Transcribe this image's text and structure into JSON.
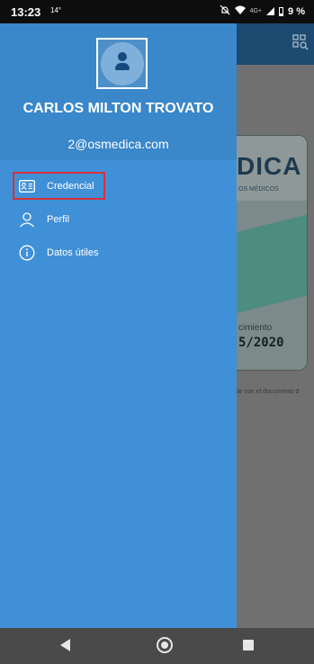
{
  "status_bar": {
    "time": "13:23",
    "temperature": "14°",
    "network": "4G+",
    "battery": "9 %"
  },
  "background_app": {
    "card_brand": "DICA",
    "card_subtitle": "OS MÉDICOS",
    "card_label": "cimiento",
    "card_date": "5/2020",
    "footnote": "se con el documento d"
  },
  "drawer": {
    "user_name": "CARLOS MILTON TROVATO",
    "user_email": "2@osmedica.com",
    "menu": [
      {
        "label": "Credencial",
        "icon": "id-card-icon"
      },
      {
        "label": "Perfil",
        "icon": "person-icon"
      },
      {
        "label": "Datos útiles",
        "icon": "info-icon"
      }
    ]
  },
  "colors": {
    "drawer_bg": "#4090d8",
    "drawer_header_bg": "#3a87ca",
    "highlight_border": "#d9303a"
  }
}
